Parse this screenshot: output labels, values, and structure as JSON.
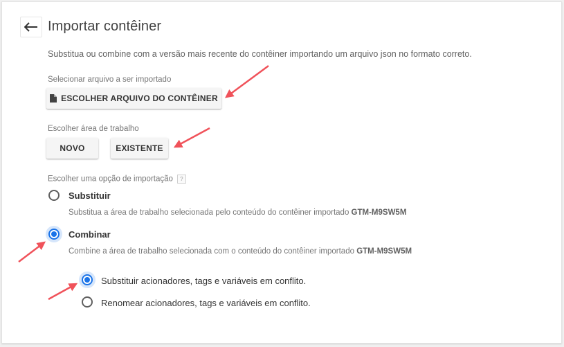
{
  "header": {
    "back_icon": "arrow-left-icon",
    "title": "Importar contêiner"
  },
  "description": "Substitua ou combine com a versão mais recente do contêiner importando um arquivo json no formato correto.",
  "file_section": {
    "label": "Selecionar arquivo a ser importado",
    "button_icon": "file-icon",
    "button_label": "ESCOLHER ARQUIVO DO CONTÊINER"
  },
  "workspace_section": {
    "label": "Escolher área de trabalho",
    "new_label": "NOVO",
    "existing_label": "EXISTENTE"
  },
  "import_option": {
    "label": "Escolher uma opção de importação",
    "help": "?",
    "options": [
      {
        "title": "Substituir",
        "desc_prefix": "Substitua a área de trabalho selecionada pelo conteúdo do contêiner importado",
        "container_id": "GTM-M9SW5M",
        "checked": false
      },
      {
        "title": "Combinar",
        "desc_prefix": "Combine a área de trabalho selecionada com o conteúdo do contêiner importado",
        "container_id": "GTM-M9SW5M",
        "checked": true
      }
    ],
    "conflict_options": [
      {
        "label": "Substituir acionadores, tags e variáveis em conflito.",
        "checked": true
      },
      {
        "label": "Renomear acionadores, tags e variáveis em conflito.",
        "checked": false
      }
    ]
  },
  "colors": {
    "accent": "#1a73e8",
    "annotation_arrow": "#f0525a"
  }
}
